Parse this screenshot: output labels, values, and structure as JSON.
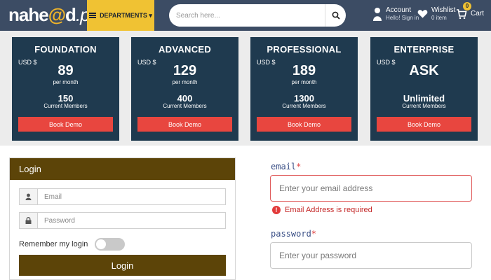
{
  "header": {
    "logo_pre": "nahe",
    "logo_accent": "@",
    "logo_mid": "d",
    "logo_suffix": ".pk",
    "departments_label": "DEPARTMENTS ▾",
    "search_placeholder": "Search here...",
    "account_title": "Account",
    "account_sub": "Hello! Sign in",
    "wishlist_title": "Wishlist",
    "wishlist_sub": "0 item",
    "cart_badge": "0",
    "cart_label": "Cart"
  },
  "plans": [
    {
      "name": "FOUNDATION",
      "currency": "USD $",
      "price": "89",
      "period": "per month",
      "members": "150",
      "members_label": "Current Members",
      "button": "Book Demo"
    },
    {
      "name": "ADVANCED",
      "currency": "USD $",
      "price": "129",
      "period": "per month",
      "members": "400",
      "members_label": "Current Members",
      "button": "Book Demo"
    },
    {
      "name": "PROFESSIONAL",
      "currency": "USD $",
      "price": "189",
      "period": "per month",
      "members": "1300",
      "members_label": "Current Members",
      "button": "Book Demo"
    },
    {
      "name": "ENTERPRISE",
      "currency": "USD $",
      "price": "ASK",
      "period": "",
      "members": "Unlimited",
      "members_label": "Current Members",
      "button": "Book Demo"
    }
  ],
  "login": {
    "title": "Login",
    "email_placeholder": "Email",
    "password_placeholder": "Password",
    "remember_label": "Remember my login",
    "button": "Login"
  },
  "form": {
    "email_label": "email",
    "required_mark": "*",
    "email_placeholder": "Enter your email address",
    "email_error": "Email Address is required",
    "password_label": "password",
    "password_placeholder": "Enter your password"
  },
  "colors": {
    "header_bg": "#3c4c64",
    "accent_yellow": "#f0c233",
    "plan_bg": "#1f3a4f",
    "demo_red": "#e8463f",
    "login_brown": "#5c4408",
    "error_red": "#c52a2a"
  }
}
